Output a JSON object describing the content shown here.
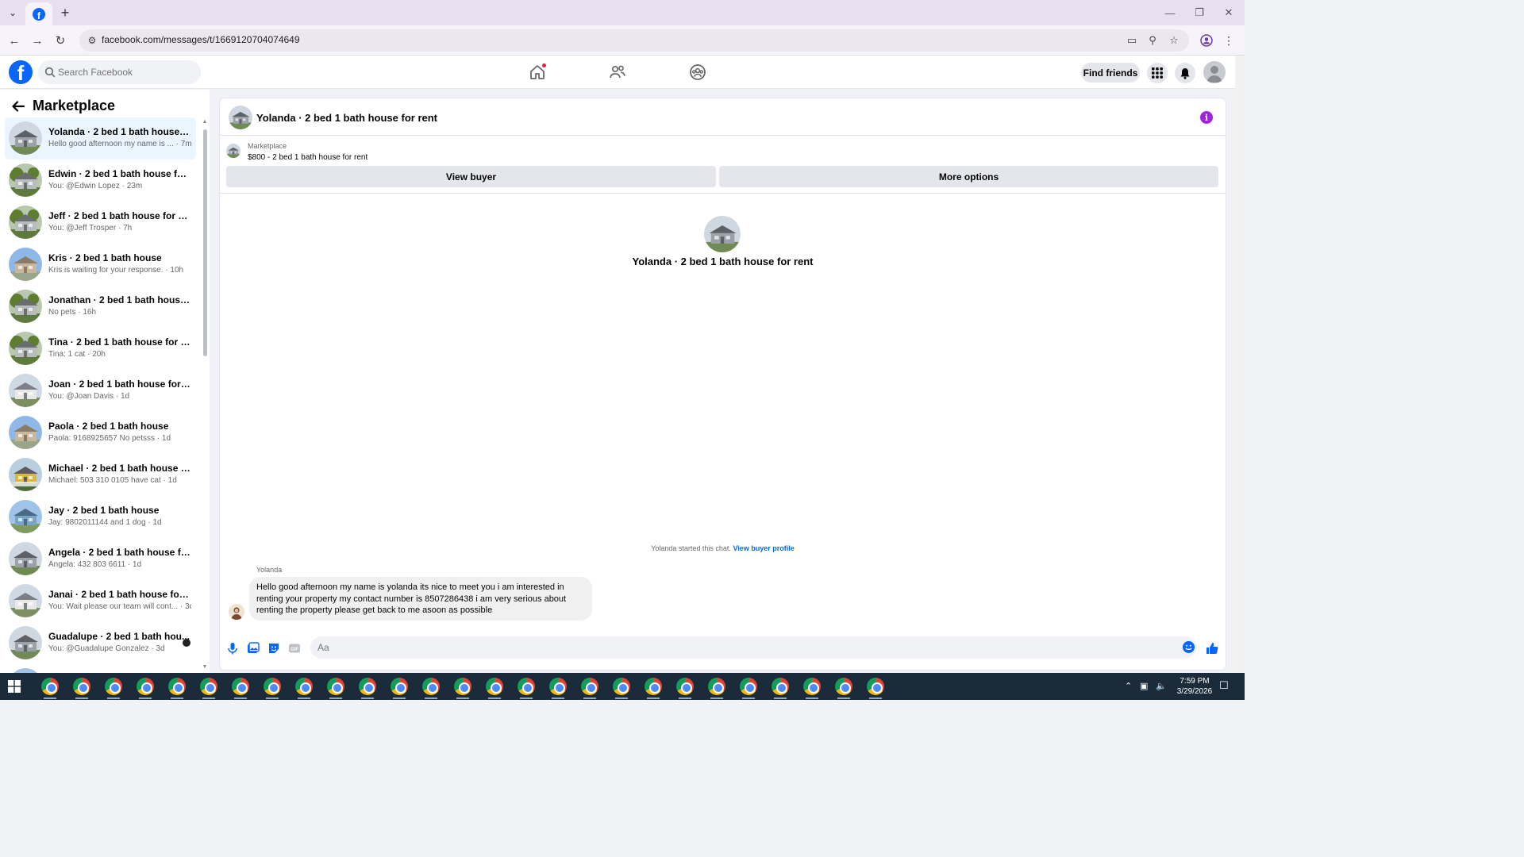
{
  "browser": {
    "url": "facebook.com/messages/t/1669120704074649"
  },
  "fb": {
    "search_placeholder": "Search Facebook",
    "find_friends": "Find friends"
  },
  "sidebar": {
    "title": "Marketplace",
    "conversations": [
      {
        "name": "Yolanda · 2 bed 1 bath house for...",
        "preview": "Hello good afternoon my name is ... · 7m",
        "thumb": "house-grey"
      },
      {
        "name": "Edwin · 2 bed 1 bath house for r...",
        "preview": "You: @Edwin Lopez · 23m",
        "thumb": "house-tree"
      },
      {
        "name": "Jeff · 2 bed 1 bath house for rent",
        "preview": "You: @Jeff Trosper · 7h",
        "thumb": "house-tree"
      },
      {
        "name": "Kris · 2 bed 1 bath house",
        "preview": "Kris is waiting for your response. · 10h",
        "thumb": "house-tan"
      },
      {
        "name": "Jonathan · 2 bed 1 bath house f...",
        "preview": "No pets · 16h",
        "thumb": "house-tree"
      },
      {
        "name": "Tina · 2 bed 1 bath house for rent",
        "preview": "Tina: 1 cat · 20h",
        "thumb": "house-tree"
      },
      {
        "name": "Joan · 2 bed 1 bath house for rent",
        "preview": "You: @Joan Davis · 1d",
        "thumb": "house-white"
      },
      {
        "name": "Paola · 2 bed 1 bath house",
        "preview": "Paola: 9168925657 No petsss · 1d",
        "thumb": "house-tan"
      },
      {
        "name": "Michael · 2 bed 1 bath house for...",
        "preview": "Michael: 503 310 0105 have cat · 1d",
        "thumb": "house-yellow"
      },
      {
        "name": "Jay · 2 bed 1 bath house",
        "preview": "Jay: 9802011144 and 1 dog · 1d",
        "thumb": "house-blue"
      },
      {
        "name": "Angela · 2 bed 1 bath house for ...",
        "preview": "Angela: 432 803 6611 · 1d",
        "thumb": "house-grey"
      },
      {
        "name": "Janai · 2 bed 1 bath house for rent",
        "preview": "You: Wait please our team will cont... · 3d",
        "thumb": "house-white"
      },
      {
        "name": "Guadalupe · 2 bed 1 bath hou...",
        "preview": "You: @Guadalupe Gonzalez · 3d",
        "thumb": "house-grey"
      },
      {
        "name": "",
        "preview": "",
        "thumb": "house-blue"
      }
    ]
  },
  "chat": {
    "title": "Yolanda · 2 bed 1 bath house for rent",
    "listing_source": "Marketplace",
    "listing_price": "$800 - 2 bed 1 bath house for rent",
    "view_buyer": "View buyer",
    "more_options": "More options",
    "intro_title": "Yolanda · 2 bed 1 bath house for rent",
    "started_text": "Yolanda started this chat.",
    "view_buyer_profile": "View buyer profile",
    "sender": "Yolanda",
    "message_lines": [
      "Hello good afternoon my name is yolanda its nice to meet you i am interested in",
      "renting your property my contact number is 8507286438 i am very serious about",
      "renting the property please get back to me asoon as possible"
    ],
    "input_placeholder": "Aa"
  },
  "taskbar": {
    "time": "7:59 PM",
    "date": "3/29/2026"
  },
  "colors": {
    "fb_blue": "#0866ff",
    "info_purple": "#9f23e0",
    "active_row": "#ebf5ff"
  }
}
